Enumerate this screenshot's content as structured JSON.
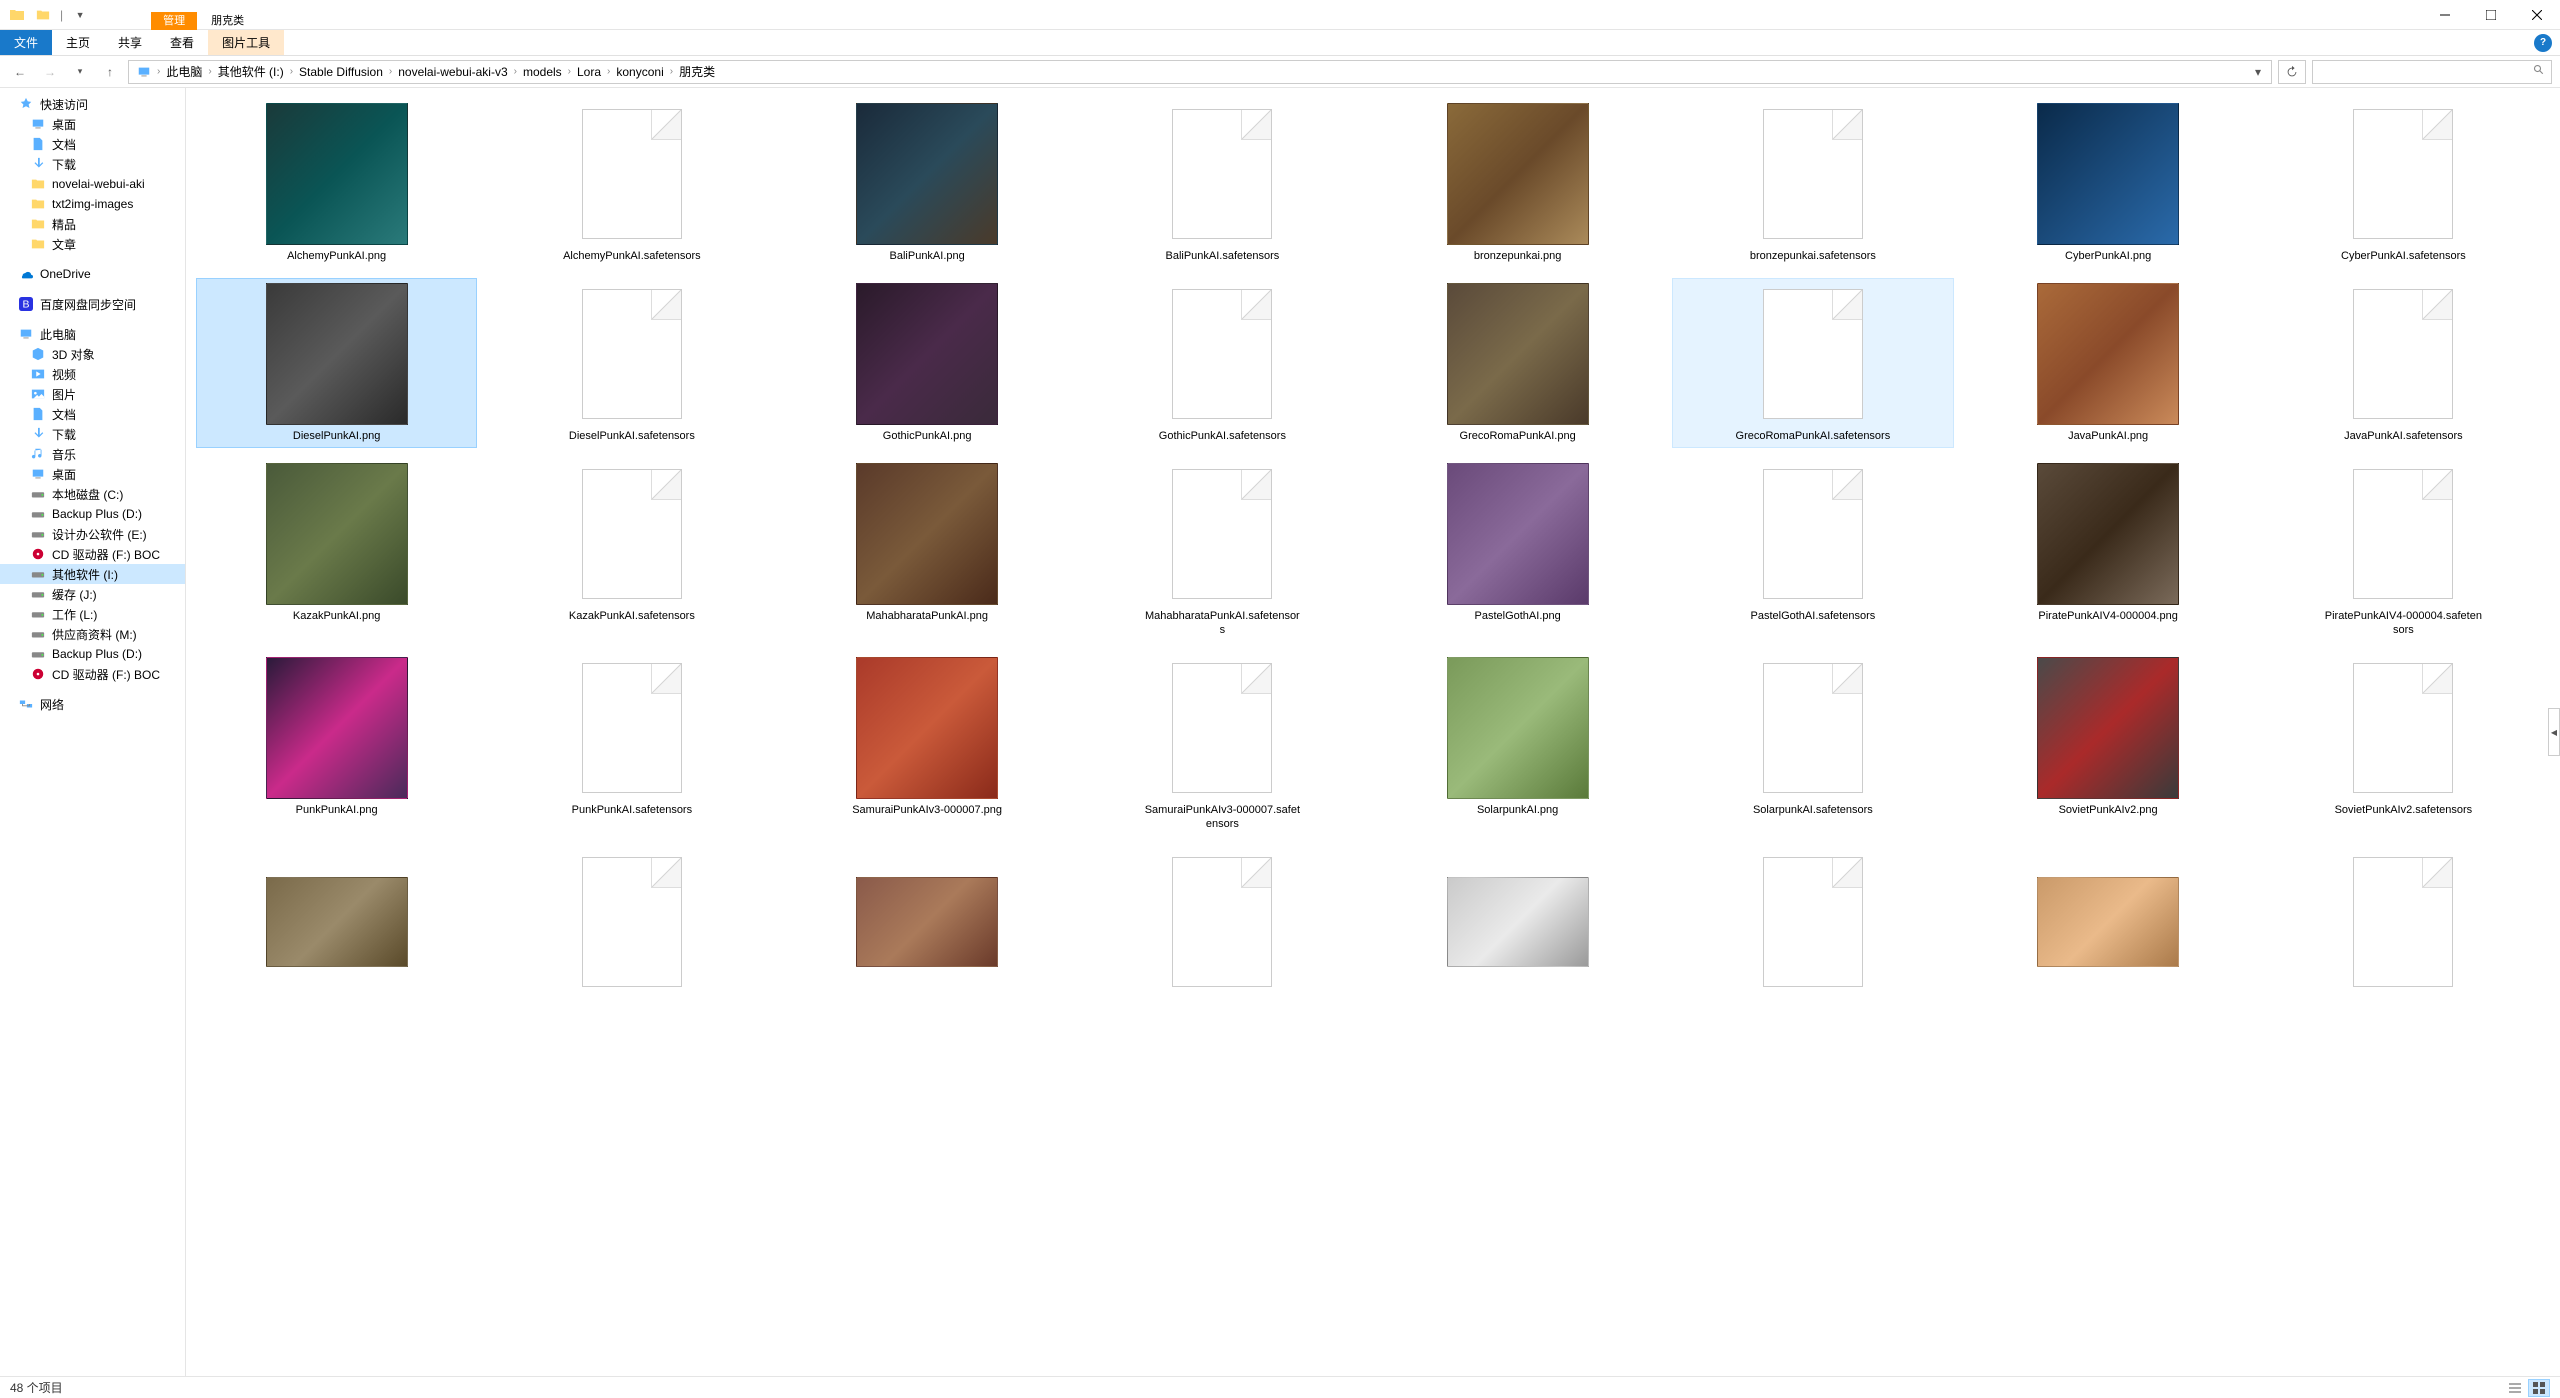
{
  "window": {
    "context_tab": "管理",
    "folder_tab": "朋克类"
  },
  "ribbon": {
    "file": "文件",
    "home": "主页",
    "share": "共享",
    "view": "查看",
    "pic_tools": "图片工具"
  },
  "breadcrumb": {
    "items": [
      "此电脑",
      "其他软件 (I:)",
      "Stable Diffusion",
      "novelai-webui-aki-v3",
      "models",
      "Lora",
      "konyconi",
      "朋克类"
    ]
  },
  "search": {
    "placeholder": ""
  },
  "nav": {
    "quick_access": "快速访问",
    "quick_items": [
      {
        "label": "桌面",
        "icon": "desktop"
      },
      {
        "label": "文档",
        "icon": "doc"
      },
      {
        "label": "下载",
        "icon": "download"
      },
      {
        "label": "novelai-webui-aki",
        "icon": "folder"
      },
      {
        "label": "txt2img-images",
        "icon": "folder"
      },
      {
        "label": "精品",
        "icon": "folder"
      },
      {
        "label": "文章",
        "icon": "folder"
      }
    ],
    "onedrive": "OneDrive",
    "baidu": "百度网盘同步空间",
    "this_pc": "此电脑",
    "pc_items": [
      {
        "label": "3D 对象",
        "icon": "3d"
      },
      {
        "label": "视频",
        "icon": "video"
      },
      {
        "label": "图片",
        "icon": "pic"
      },
      {
        "label": "文档",
        "icon": "doc"
      },
      {
        "label": "下载",
        "icon": "download"
      },
      {
        "label": "音乐",
        "icon": "music"
      },
      {
        "label": "桌面",
        "icon": "desktop"
      },
      {
        "label": "本地磁盘 (C:)",
        "icon": "drive"
      },
      {
        "label": "Backup Plus (D:)",
        "icon": "drive"
      },
      {
        "label": "设计办公软件 (E:)",
        "icon": "drive"
      },
      {
        "label": "CD 驱动器 (F:) BOC",
        "icon": "cd"
      },
      {
        "label": "其他软件 (I:)",
        "icon": "drive",
        "selected": true
      },
      {
        "label": "缓存 (J:)",
        "icon": "drive"
      },
      {
        "label": "工作 (L:)",
        "icon": "drive"
      },
      {
        "label": "供应商资料 (M:)",
        "icon": "drive"
      },
      {
        "label": "Backup Plus (D:)",
        "icon": "drive"
      },
      {
        "label": "CD 驱动器 (F:) BOC",
        "icon": "cd"
      }
    ],
    "network": "网络"
  },
  "files": [
    {
      "name": "AlchemyPunkAI.png",
      "type": "img",
      "bg": "linear-gradient(135deg,#1a3a3a,#0a5555,#2a7a7a)",
      "selected": false
    },
    {
      "name": "AlchemyPunkAI.safetensors",
      "type": "file"
    },
    {
      "name": "BaliPunkAI.png",
      "type": "img",
      "bg": "linear-gradient(135deg,#1a2a3a,#2a4a5a,#4a3a2a)"
    },
    {
      "name": "BaliPunkAI.safetensors",
      "type": "file"
    },
    {
      "name": "bronzepunkai.png",
      "type": "img",
      "bg": "linear-gradient(135deg,#8a6a3a,#6a4a2a,#aa8a5a)"
    },
    {
      "name": "bronzepunkai.safetensors",
      "type": "file"
    },
    {
      "name": "CyberPunkAI.png",
      "type": "img",
      "bg": "linear-gradient(135deg,#0a2a4a,#1a4a7a,#2a6aaa)"
    },
    {
      "name": "CyberPunkAI.safetensors",
      "type": "file"
    },
    {
      "name": "DieselPunkAI.png",
      "type": "img",
      "bg": "linear-gradient(135deg,#3a3a3a,#5a5a5a,#2a2a2a)",
      "selected": true
    },
    {
      "name": "DieselPunkAI.safetensors",
      "type": "file"
    },
    {
      "name": "GothicPunkAI.png",
      "type": "img",
      "bg": "linear-gradient(135deg,#2a1a2a,#4a2a4a,#3a2a3a)"
    },
    {
      "name": "GothicPunkAI.safetensors",
      "type": "file"
    },
    {
      "name": "GrecoRomaPunkAI.png",
      "type": "img",
      "bg": "linear-gradient(135deg,#5a4a3a,#7a6a4a,#4a3a2a)"
    },
    {
      "name": "GrecoRomaPunkAI.safetensors",
      "type": "file",
      "hover": true
    },
    {
      "name": "JavaPunkAI.png",
      "type": "img",
      "bg": "linear-gradient(135deg,#aa6a3a,#8a4a2a,#ca8a5a)"
    },
    {
      "name": "JavaPunkAI.safetensors",
      "type": "file"
    },
    {
      "name": "KazakPunkAI.png",
      "type": "img",
      "bg": "linear-gradient(135deg,#4a5a3a,#6a7a4a,#3a4a2a)"
    },
    {
      "name": "KazakPunkAI.safetensors",
      "type": "file"
    },
    {
      "name": "MahabharataPunkAI.png",
      "type": "img",
      "bg": "linear-gradient(135deg,#5a3a2a,#7a5a3a,#4a2a1a)"
    },
    {
      "name": "MahabharataPunkAI.safetensors",
      "type": "file"
    },
    {
      "name": "PastelGothAI.png",
      "type": "img",
      "bg": "linear-gradient(135deg,#6a4a7a,#8a6a9a,#5a3a6a)"
    },
    {
      "name": "PastelGothAI.safetensors",
      "type": "file"
    },
    {
      "name": "PiratePunkAIV4-000004.png",
      "type": "img",
      "bg": "linear-gradient(135deg,#5a4a3a,#3a2a1a,#7a6a5a)"
    },
    {
      "name": "PiratePunkAIV4-000004.safetensors",
      "type": "file"
    },
    {
      "name": "PunkPunkAI.png",
      "type": "img",
      "bg": "linear-gradient(135deg,#2a1a3a,#ca2a8a,#4a2a5a)"
    },
    {
      "name": "PunkPunkAI.safetensors",
      "type": "file"
    },
    {
      "name": "SamuraiPunkAIv3-000007.png",
      "type": "img",
      "bg": "linear-gradient(135deg,#aa3a2a,#ca5a3a,#8a2a1a)"
    },
    {
      "name": "SamuraiPunkAIv3-000007.safetensors",
      "type": "file"
    },
    {
      "name": "SolarpunkAI.png",
      "type": "img",
      "bg": "linear-gradient(135deg,#7a9a5a,#9aba7a,#5a7a3a)"
    },
    {
      "name": "SolarpunkAI.safetensors",
      "type": "file"
    },
    {
      "name": "SovietPunkAIv2.png",
      "type": "img",
      "bg": "linear-gradient(135deg,#4a4a4a,#aa2a2a,#3a3a3a)"
    },
    {
      "name": "SovietPunkAIv2.safetensors",
      "type": "file"
    },
    {
      "name": "",
      "type": "img",
      "bg": "linear-gradient(135deg,#7a6a4a,#9a8a6a,#5a4a2a)",
      "partial": true
    },
    {
      "name": "",
      "type": "file",
      "partial": true
    },
    {
      "name": "",
      "type": "img",
      "bg": "linear-gradient(135deg,#8a5a4a,#aa7a5a,#6a3a2a)",
      "partial": true
    },
    {
      "name": "",
      "type": "file",
      "partial": true
    },
    {
      "name": "",
      "type": "img",
      "bg": "linear-gradient(135deg,#cacaca,#eaeaea,#9a9a9a)",
      "partial": true
    },
    {
      "name": "",
      "type": "file",
      "partial": true
    },
    {
      "name": "",
      "type": "img",
      "bg": "linear-gradient(135deg,#ca9a6a,#eaba8a,#aa7a4a)",
      "partial": true
    },
    {
      "name": "",
      "type": "file",
      "partial": true
    }
  ],
  "status": {
    "text": "48 个项目"
  }
}
